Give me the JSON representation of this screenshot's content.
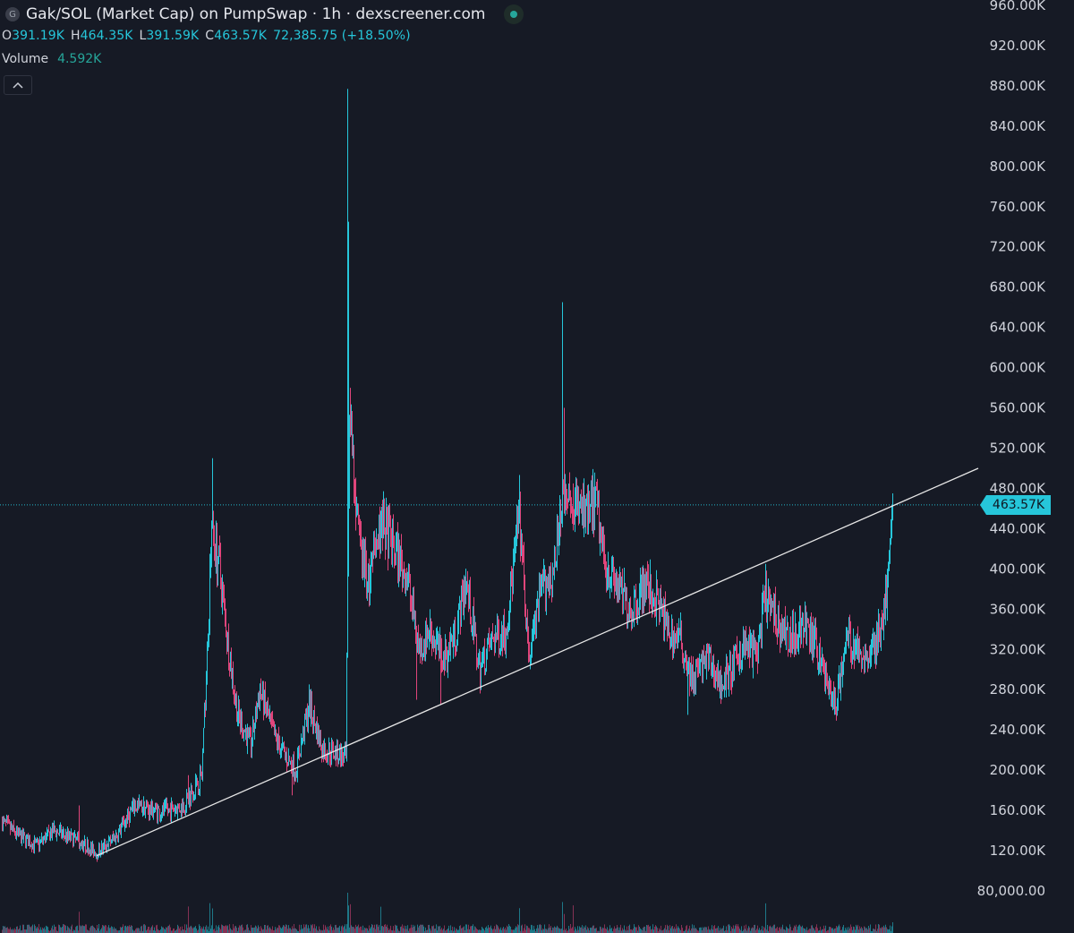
{
  "legend": {
    "symbol_initial": "G",
    "title": "Gak/SOL (Market Cap) on PumpSwap · 1h · dexscreener.com",
    "ohlc": {
      "o_label": "O",
      "o_value": "391.19K",
      "h_label": "H",
      "h_value": "464.35K",
      "l_label": "L",
      "l_value": "391.59K",
      "c_label": "C",
      "c_value": "463.57K",
      "change": "72,385.75 (+18.50%)"
    },
    "volume_label": "Volume",
    "volume_value": "4.592K",
    "collapse_icon": "chevron-up-icon"
  },
  "colors": {
    "background": "#161a25",
    "up": "#26c6da",
    "down": "#e0457b",
    "trendline": "#e6e6e6",
    "price_tag": "#26c6da",
    "axis_text": "#d1d4dc"
  },
  "chart_data": {
    "type": "candlestick",
    "timeframe": "1h",
    "y_axis_ticks": [
      "960.00K",
      "920.00K",
      "880.00K",
      "840.00K",
      "800.00K",
      "760.00K",
      "720.00K",
      "680.00K",
      "640.00K",
      "600.00K",
      "560.00K",
      "520.00K",
      "480.00K",
      "440.00K",
      "400.00K",
      "360.00K",
      "320.00K",
      "280.00K",
      "240.00K",
      "200.00K",
      "160.00K",
      "120.00K",
      "80,000.00"
    ],
    "ylim": [
      78000,
      962000
    ],
    "last_price": 463570,
    "last_price_label": "463.57K",
    "key_points": [
      {
        "label": "start",
        "value": 140000
      },
      {
        "label": "trendline_low",
        "value": 115000
      },
      {
        "label": "first_spike_high",
        "value": 510000
      },
      {
        "label": "major_spike_high",
        "value": 877000
      },
      {
        "label": "second_spike_high",
        "value": 665000
      },
      {
        "label": "late_low",
        "value": 255000
      },
      {
        "label": "last_close",
        "value": 463570
      }
    ],
    "trendline": {
      "start_value": 115000,
      "end_value": 500000
    }
  }
}
